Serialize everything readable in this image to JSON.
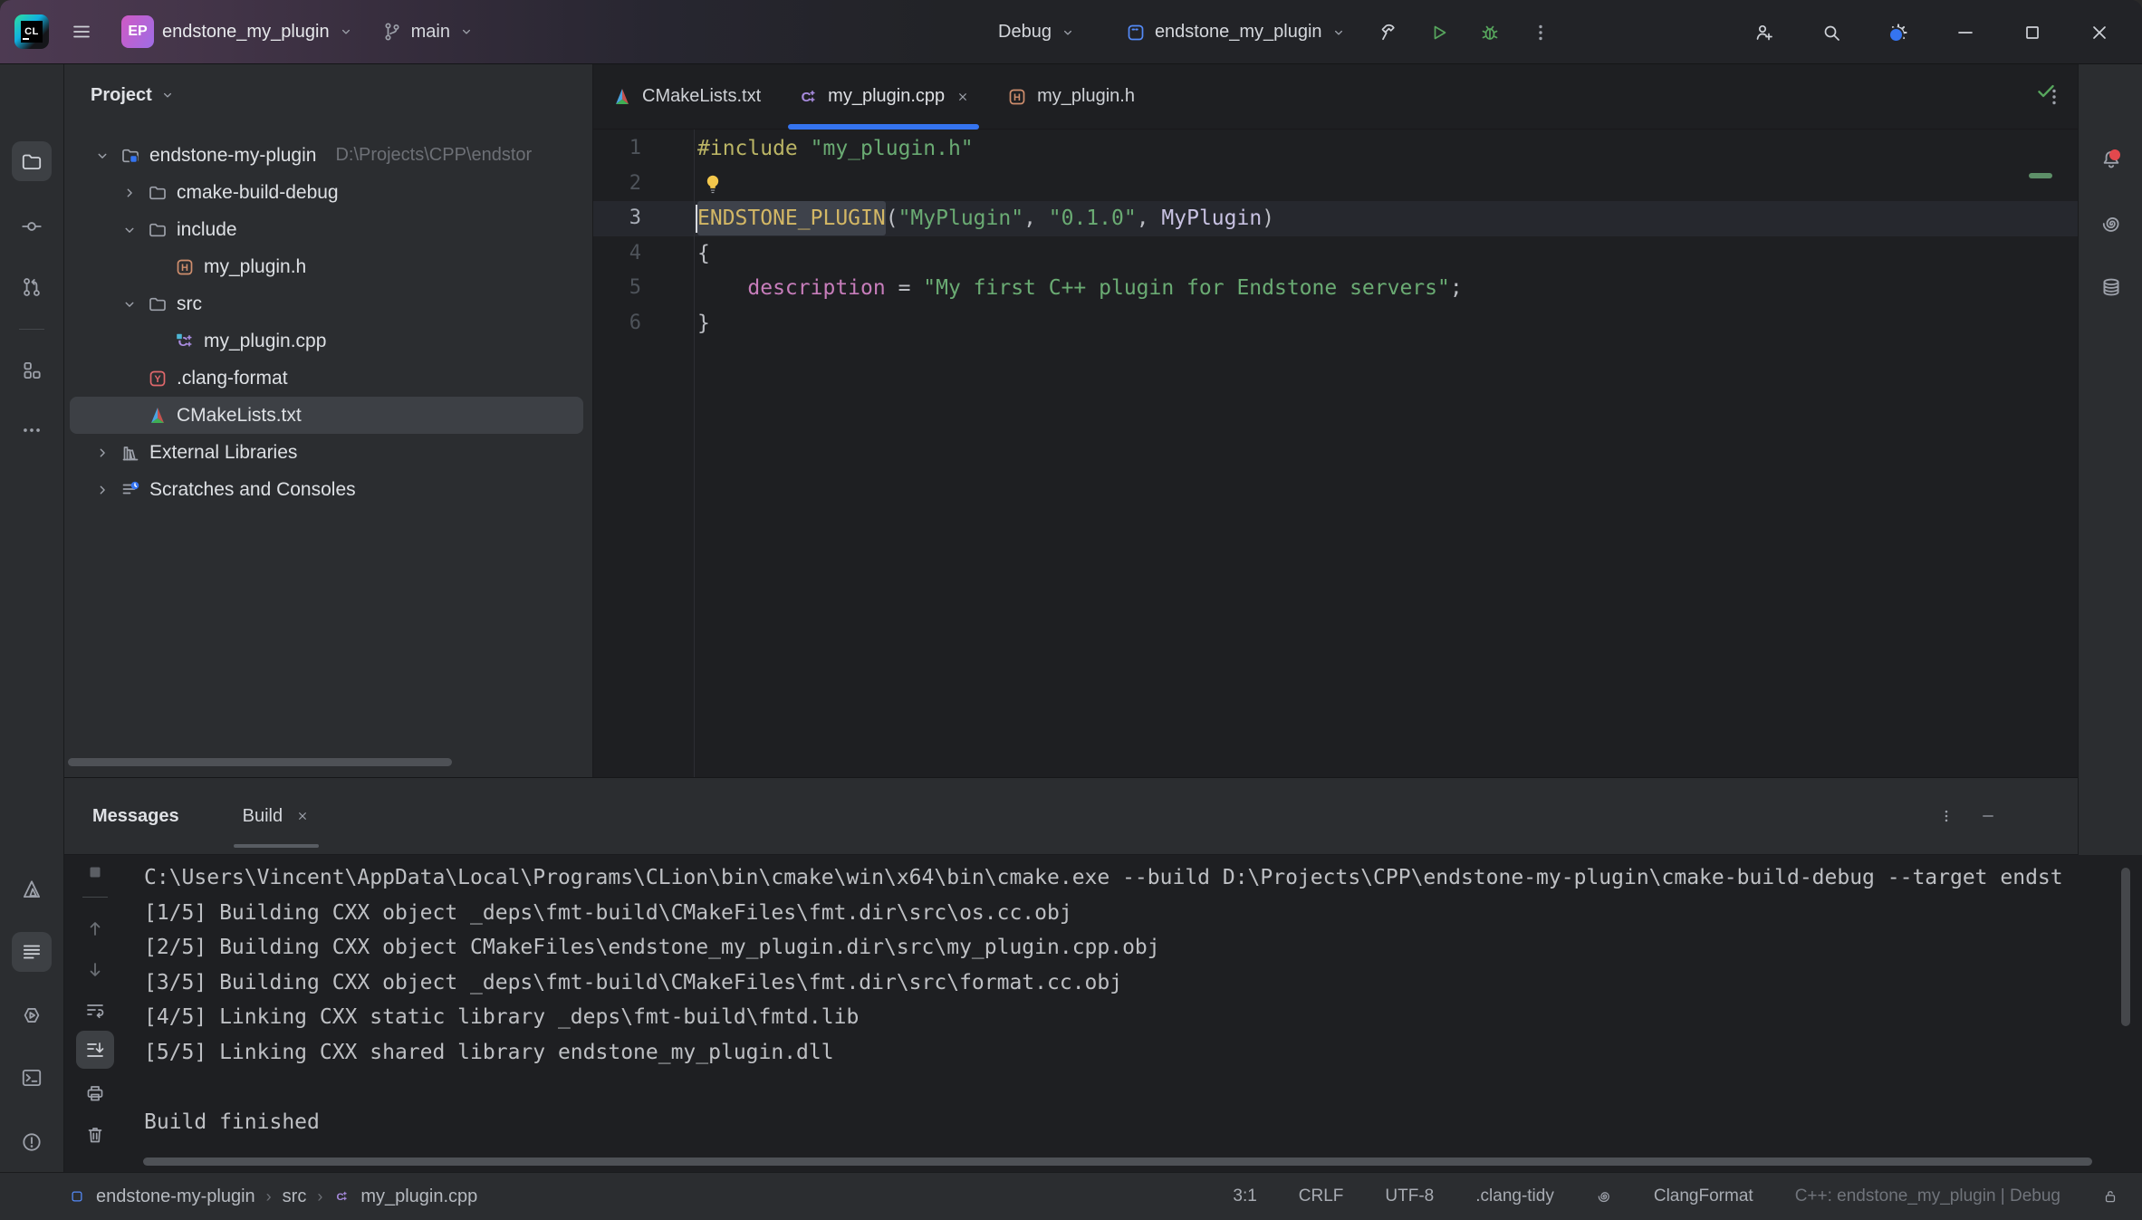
{
  "title_bar": {
    "project_badge": "EP",
    "project_name": "endstone_my_plugin",
    "branch_name": "main",
    "run_config_mode": "Debug",
    "run_config_name": "endstone_my_plugin"
  },
  "activity_bar_left": [
    "project",
    "commit",
    "pull-requests",
    "structure",
    "more",
    "cmake",
    "messages",
    "run",
    "terminal",
    "problems",
    "version-control"
  ],
  "activity_bar_right": [
    "notifications",
    "ai-assistant",
    "database"
  ],
  "project_panel": {
    "title": "Project",
    "tree": [
      {
        "label": "endstone-my-plugin",
        "hint": "D:\\Projects\\CPP\\endstor",
        "icon": "proj-folder",
        "chevron": "expanded",
        "depth": 0
      },
      {
        "label": "cmake-build-debug",
        "icon": "folder",
        "chevron": "collapsed",
        "depth": 1
      },
      {
        "label": "include",
        "icon": "folder",
        "chevron": "expanded",
        "depth": 1
      },
      {
        "label": "my_plugin.h",
        "icon": "file-h",
        "chevron": "none",
        "depth": 2
      },
      {
        "label": "src",
        "icon": "folder",
        "chevron": "expanded",
        "depth": 1
      },
      {
        "label": "my_plugin.cpp",
        "icon": "file-cpp-b",
        "chevron": "none",
        "depth": 2
      },
      {
        "label": ".clang-format",
        "icon": "file-yaml",
        "chevron": "none",
        "depth": 1
      },
      {
        "label": "CMakeLists.txt",
        "icon": "file-cmake",
        "chevron": "none",
        "depth": 1,
        "selected": true
      },
      {
        "label": "External Libraries",
        "icon": "libs",
        "chevron": "collapsed",
        "depth": 0
      },
      {
        "label": "Scratches and Consoles",
        "icon": "scratch",
        "chevron": "collapsed",
        "depth": 0
      }
    ]
  },
  "editor": {
    "tabs": [
      {
        "label": "CMakeLists.txt",
        "icon": "file-cmake",
        "active": false,
        "closable": false
      },
      {
        "label": "my_plugin.cpp",
        "icon": "file-cpp",
        "active": true,
        "closable": true
      },
      {
        "label": "my_plugin.h",
        "icon": "file-h",
        "active": false,
        "closable": false
      }
    ],
    "lines": [
      {
        "num": "1",
        "segments": [
          {
            "t": "#include",
            "c": "directive"
          },
          {
            "t": " ",
            "c": "plain"
          },
          {
            "t": "\"my_plugin.h\"",
            "c": "string"
          }
        ]
      },
      {
        "num": "2",
        "bulb": true,
        "segments": []
      },
      {
        "num": "3",
        "current": true,
        "caret": true,
        "segments": [
          {
            "t": "ENDSTONE_PLUGIN",
            "c": "macro",
            "hl": true
          },
          {
            "t": "(",
            "c": "plain"
          },
          {
            "t": "\"MyPlugin\"",
            "c": "string"
          },
          {
            "t": ", ",
            "c": "plain"
          },
          {
            "t": "\"0.1.0\"",
            "c": "string"
          },
          {
            "t": ", ",
            "c": "plain"
          },
          {
            "t": "MyPlugin",
            "c": "class"
          },
          {
            "t": ")",
            "c": "plain"
          }
        ]
      },
      {
        "num": "4",
        "segments": [
          {
            "t": "{",
            "c": "plain"
          }
        ]
      },
      {
        "num": "5",
        "segments": [
          {
            "t": "    ",
            "c": "plain"
          },
          {
            "t": "description",
            "c": "field"
          },
          {
            "t": " = ",
            "c": "plain"
          },
          {
            "t": "\"My first C++ plugin for Endstone servers\"",
            "c": "string"
          },
          {
            "t": ";",
            "c": "plain"
          }
        ]
      },
      {
        "num": "6",
        "segments": [
          {
            "t": "}",
            "c": "plain"
          }
        ]
      }
    ]
  },
  "messages_panel": {
    "title": "Messages",
    "tab_label": "Build",
    "console_lines": [
      "C:\\Users\\Vincent\\AppData\\Local\\Programs\\CLion\\bin\\cmake\\win\\x64\\bin\\cmake.exe --build D:\\Projects\\CPP\\endstone-my-plugin\\cmake-build-debug --target endst",
      "[1/5] Building CXX object _deps\\fmt-build\\CMakeFiles\\fmt.dir\\src\\os.cc.obj",
      "[2/5] Building CXX object CMakeFiles\\endstone_my_plugin.dir\\src\\my_plugin.cpp.obj",
      "[3/5] Building CXX object _deps\\fmt-build\\CMakeFiles\\fmt.dir\\src\\format.cc.obj",
      "[4/5] Linking CXX static library _deps\\fmt-build\\fmtd.lib",
      "[5/5] Linking CXX shared library endstone_my_plugin.dll",
      "",
      "Build finished"
    ]
  },
  "status_bar": {
    "breadcrumbs": [
      "endstone-my-plugin",
      "src",
      "my_plugin.cpp"
    ],
    "caret_position": "3:1",
    "line_separator": "CRLF",
    "encoding": "UTF-8",
    "clang_tidy": ".clang-tidy",
    "clang_format": "ClangFormat",
    "cpp_context": "C++: endstone_my_plugin | Debug"
  },
  "colors": {
    "accent_blue": "#3574f0",
    "run_green": "#57a65d",
    "notification_red": "#e3484d",
    "chrome": "#2b2d30",
    "editor_bg": "#1e1f22"
  }
}
